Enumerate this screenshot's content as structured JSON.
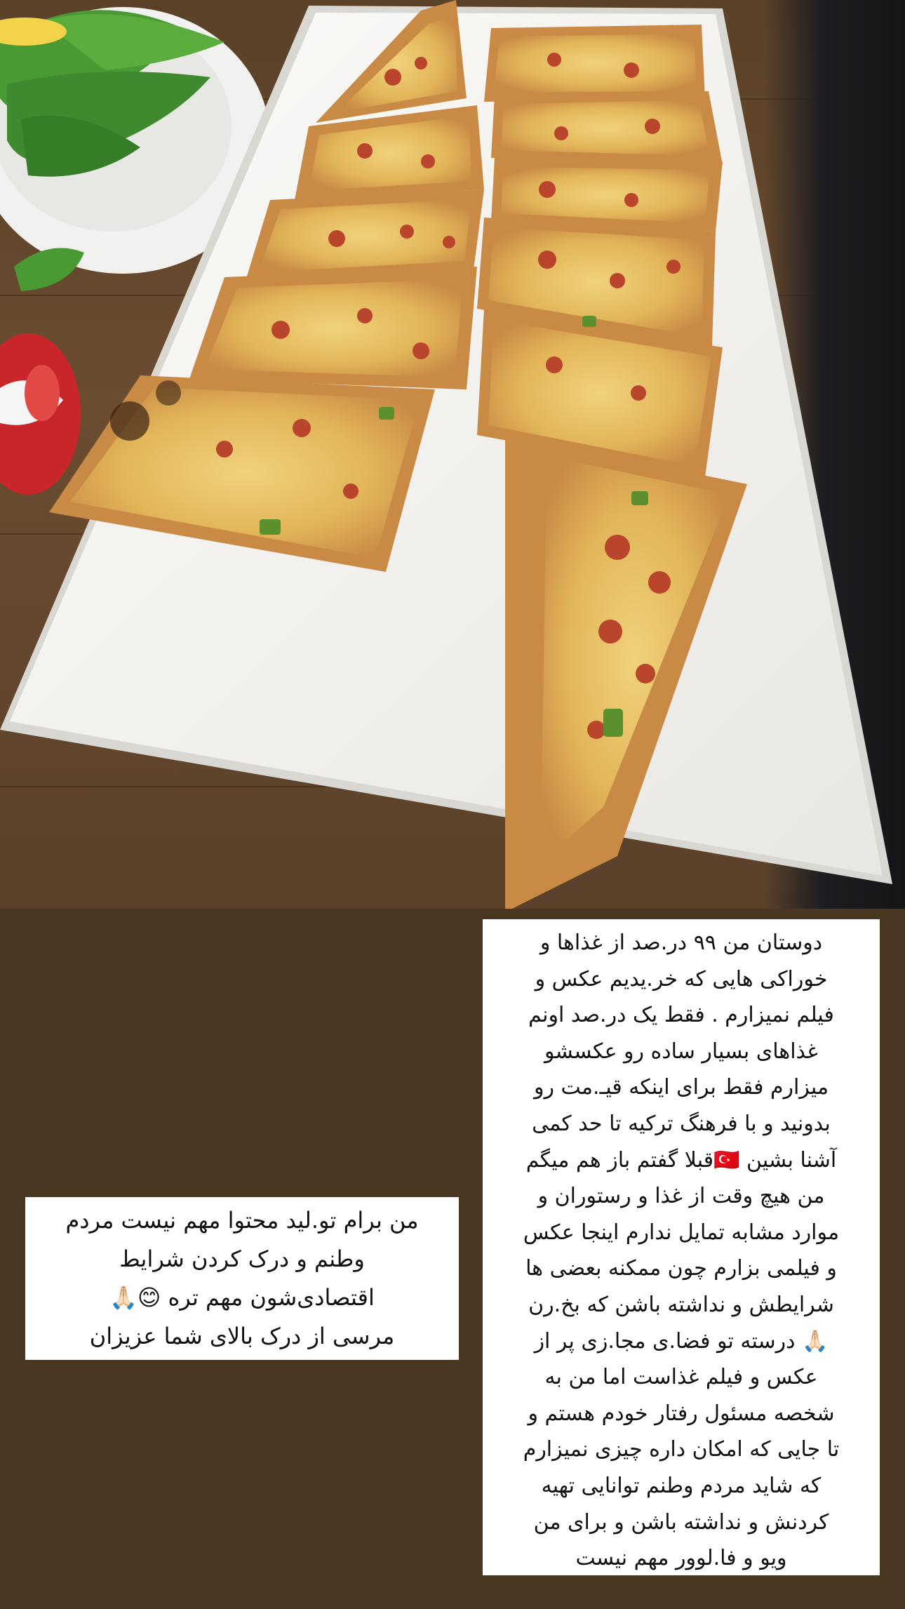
{
  "captions": {
    "right_text": "دوستان من ۹۹ در.صد از غذاها و\nخوراکی هایی که خر.یدیم عکس و\nفیلم نمیزارم . فقط یک در.صد اونم\nغذاهای بسیار ساده رو عکسشو\nمیزارم فقط برای اینکه قیـ.مت رو\nبدونید و با فرهنگ ترکیه تا حد کمی\nآشنا بشین 🇹🇷قبلا گفتم باز هم میگم\nمن هیچ وقت از غذا و رستوران و\nموارد مشابه تمایل ندارم اینجا عکس\nو فیلمی بزارم چون ممکنه بعضی ها\nشرایطش و نداشته باشن که بخ.رن\n🙏🏻 درسته تو فضا.ی مجا.زی پر از\nعکس و فیلم غذاست اما من به\nشخصه مسئول رفتار خودم هستم و\nتا جایی که امکان داره چیزی نمیزارم\nکه شاید مردم وطنم توانایی تهیه\nکردنش و نداشته باشن و برای من\nویو و فا.لوور مهم نیست",
    "left_text": "من برام تو.لید محتوا مهم نیست مردم\nوطنم و درک کردن شرایط\nاقتصادی‌شون مهم تره 😊🙏🏻\nمرسی از درک بالای شما عزیزان"
  },
  "photo": {
    "subject": "Turkish pide sliced on a rectangular white platter, arugula plate and red can on a wooden table",
    "colors": {
      "table": "#6b4c30",
      "platter": "#f4f3f0",
      "crust": "#c98a46",
      "cheese": "#e7c46a",
      "topping": "#b8452c",
      "greens": "#3f8a2e",
      "panel": "#4a3722"
    }
  }
}
